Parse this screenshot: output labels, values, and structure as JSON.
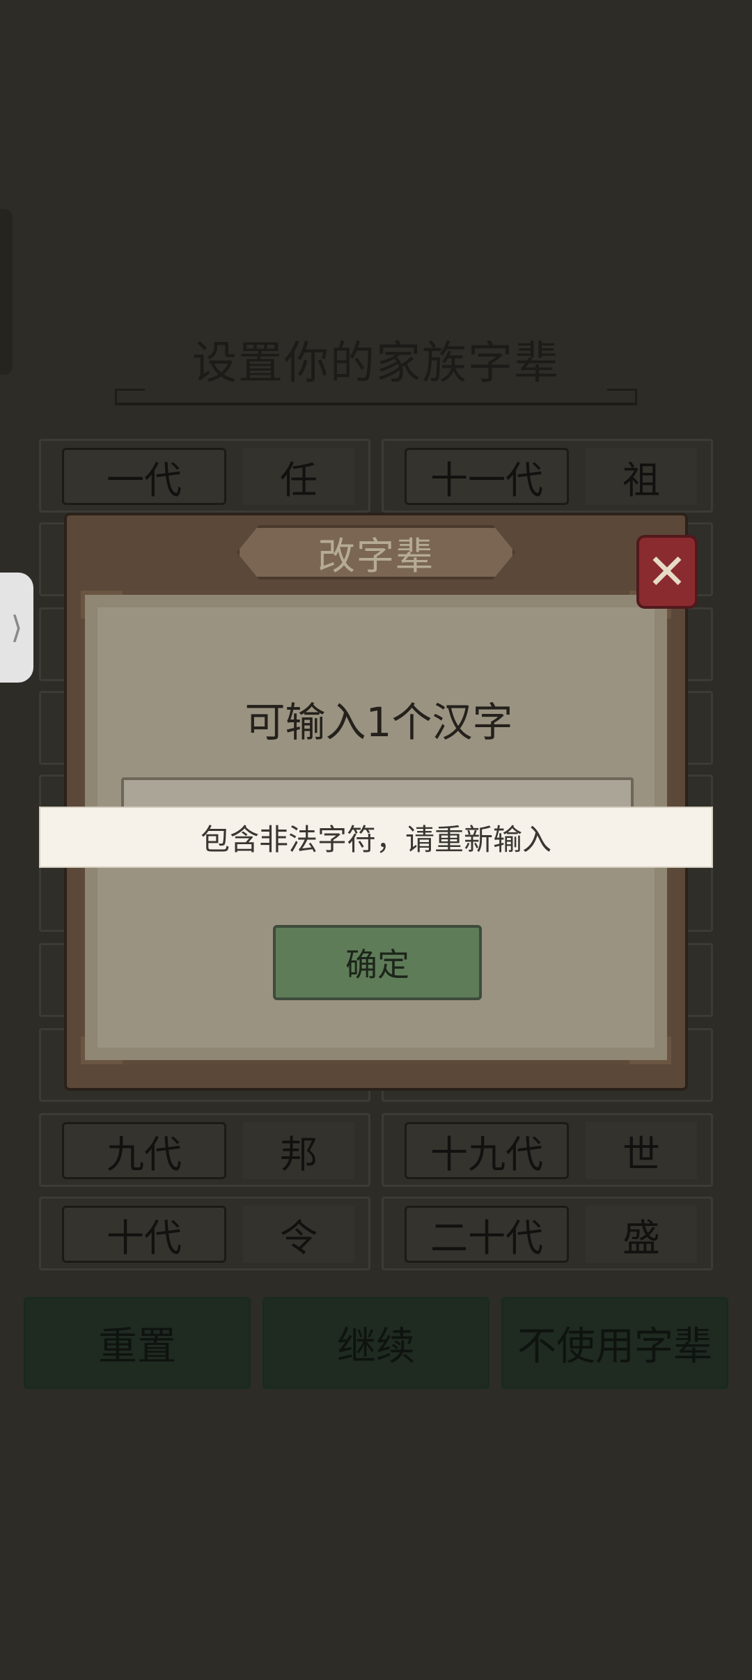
{
  "page": {
    "title": "设置你的家族字辈"
  },
  "generations": [
    {
      "label": "一代",
      "char": "任"
    },
    {
      "label": "十一代",
      "char": "祖"
    },
    {
      "label": "九代",
      "char": "邦"
    },
    {
      "label": "十九代",
      "char": "世"
    },
    {
      "label": "十代",
      "char": "令"
    },
    {
      "label": "二十代",
      "char": "盛"
    }
  ],
  "actions": {
    "reset": "重置",
    "continue": "继续",
    "no_generation_names": "不使用字辈"
  },
  "dialog": {
    "title": "改字辈",
    "prompt": "可输入1个汉字",
    "input_value": "",
    "confirm": "确定",
    "close_icon": "close-x-icon"
  },
  "toast": {
    "message": "包含非法字符，请重新输入"
  },
  "side_handle": {
    "icon": "chevron-right-icon",
    "glyph": "⟩"
  }
}
